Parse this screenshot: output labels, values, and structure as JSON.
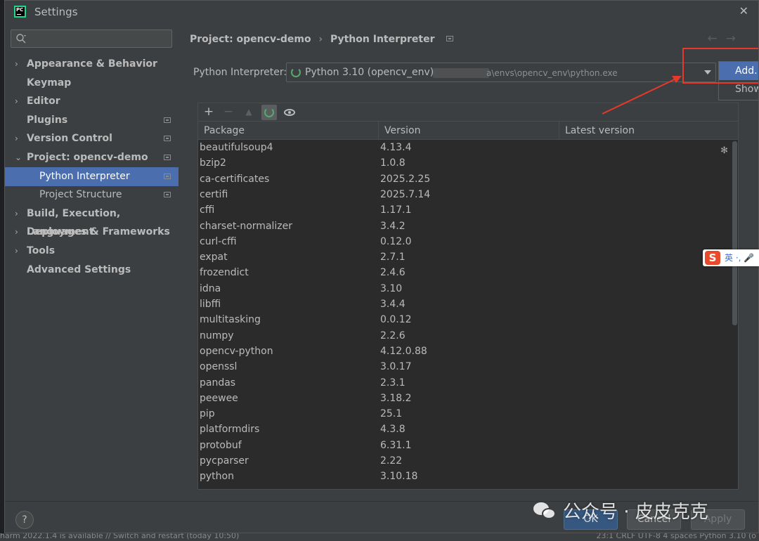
{
  "window": {
    "title": "Settings",
    "app_icon_text": "PC"
  },
  "search": {
    "placeholder": ""
  },
  "sidebar": {
    "items": [
      {
        "label": "Appearance & Behavior",
        "chevron": "›"
      },
      {
        "label": "Keymap",
        "chevron": ""
      },
      {
        "label": "Editor",
        "chevron": "›"
      },
      {
        "label": "Plugins",
        "chevron": ""
      },
      {
        "label": "Version Control",
        "chevron": "›"
      },
      {
        "label": "Project: opencv-demo",
        "chevron": "⌄"
      },
      {
        "label": "Python Interpreter",
        "chevron": ""
      },
      {
        "label": "Project Structure",
        "chevron": ""
      },
      {
        "label": "Build, Execution, Deployment",
        "chevron": "›"
      },
      {
        "label": "Languages & Frameworks",
        "chevron": "›"
      },
      {
        "label": "Tools",
        "chevron": "›"
      },
      {
        "label": "Advanced Settings",
        "chevron": ""
      }
    ]
  },
  "breadcrumb": {
    "project": "Project: opencv-demo",
    "separator": "›",
    "page": "Python Interpreter"
  },
  "nav": {
    "back": "←",
    "forward": "→"
  },
  "interpreter": {
    "label": "Python Interpreter:",
    "name": "Python 3.10 (opencv_env)",
    "path": "a\\envs\\opencv_env\\python.exe"
  },
  "add_menu": {
    "add": "Add...",
    "show": "Show"
  },
  "toolbar": {
    "add": "+",
    "remove": "−",
    "upgrade": "▲"
  },
  "table": {
    "headers": [
      "Package",
      "Version",
      "Latest version"
    ],
    "rows": [
      [
        "beautifulsoup4",
        "4.13.4",
        ""
      ],
      [
        "bzip2",
        "1.0.8",
        ""
      ],
      [
        "ca-certificates",
        "2025.2.25",
        ""
      ],
      [
        "certifi",
        "2025.7.14",
        ""
      ],
      [
        "cffi",
        "1.17.1",
        ""
      ],
      [
        "charset-normalizer",
        "3.4.2",
        ""
      ],
      [
        "curl-cffi",
        "0.12.0",
        ""
      ],
      [
        "expat",
        "2.7.1",
        ""
      ],
      [
        "frozendict",
        "2.4.6",
        ""
      ],
      [
        "idna",
        "3.10",
        ""
      ],
      [
        "libffi",
        "3.4.4",
        ""
      ],
      [
        "multitasking",
        "0.0.12",
        ""
      ],
      [
        "numpy",
        "2.2.6",
        ""
      ],
      [
        "opencv-python",
        "4.12.0.88",
        ""
      ],
      [
        "openssl",
        "3.0.17",
        ""
      ],
      [
        "pandas",
        "2.3.1",
        ""
      ],
      [
        "peewee",
        "3.18.2",
        ""
      ],
      [
        "pip",
        "25.1",
        ""
      ],
      [
        "platformdirs",
        "4.3.8",
        ""
      ],
      [
        "protobuf",
        "6.31.1",
        ""
      ],
      [
        "pycparser",
        "2.22",
        ""
      ],
      [
        "python",
        "3.10.18",
        ""
      ]
    ]
  },
  "footer": {
    "help": "?",
    "ok": "OK",
    "cancel": "Cancel",
    "apply": "Apply"
  },
  "watermark": {
    "text": "公众号 · 皮皮克克"
  },
  "ime": {
    "logo": "S",
    "text": "英 ·, 🎤"
  },
  "statusbar": {
    "left": "harm 2022.1.4 is available // Switch and restart (today 10:50)",
    "right": "23:1   CRLF   UTF-8   4 spaces   Python 3.10 (o"
  },
  "colors": {
    "accent": "#4b6eaf",
    "annotation": "#e6382b",
    "loading": "#59a869"
  }
}
